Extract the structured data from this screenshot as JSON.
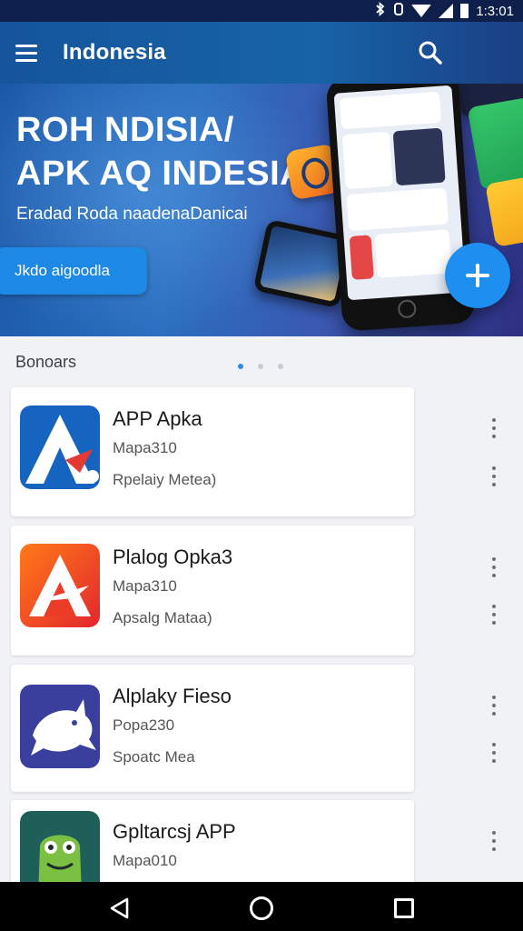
{
  "status_bar": {
    "time": "1:3:01",
    "icons": [
      "bluetooth-icon",
      "vibrate-icon",
      "wifi-icon",
      "signal-icon",
      "battery-icon"
    ]
  },
  "app_bar": {
    "title": "Indonesia",
    "menu_icon": "hamburger-menu-icon",
    "search_icon": "search-icon",
    "color": "#1763a6"
  },
  "hero": {
    "headline_1": "ROH NDISIA/",
    "headline_2": "APK AQ INDESIA",
    "subtitle": "Eradad Roda naadenaDanicai",
    "cta_label": "Jkdo aigoodla",
    "fab_icon": "plus-icon"
  },
  "section": {
    "title": "Bonoars",
    "carousel_pages": 3,
    "carousel_active": 1
  },
  "apps": [
    {
      "name": "APP Apka",
      "meta": "Mapa310",
      "desc": "Rpelaiy Metea)",
      "icon": "white-a-logo-icon"
    },
    {
      "name": "Plalog Opka3",
      "meta": "Mapa310",
      "desc": "Apsalg Mataa)",
      "icon": "red-a-logo-icon"
    },
    {
      "name": "Alplaky Fieso",
      "meta": "Popa230",
      "desc": "Spoatc Mea",
      "icon": "shark-icon"
    },
    {
      "name": "Gpltarcsj APP",
      "meta": "Mapa010",
      "desc": "",
      "icon": "green-monster-icon"
    }
  ],
  "nav_bar": {
    "icons": [
      "back-icon",
      "home-icon",
      "recents-icon"
    ]
  },
  "colors": {
    "primary": "#1763a6",
    "accent": "#1e8ff0",
    "list_background": "#f1f2f5"
  }
}
